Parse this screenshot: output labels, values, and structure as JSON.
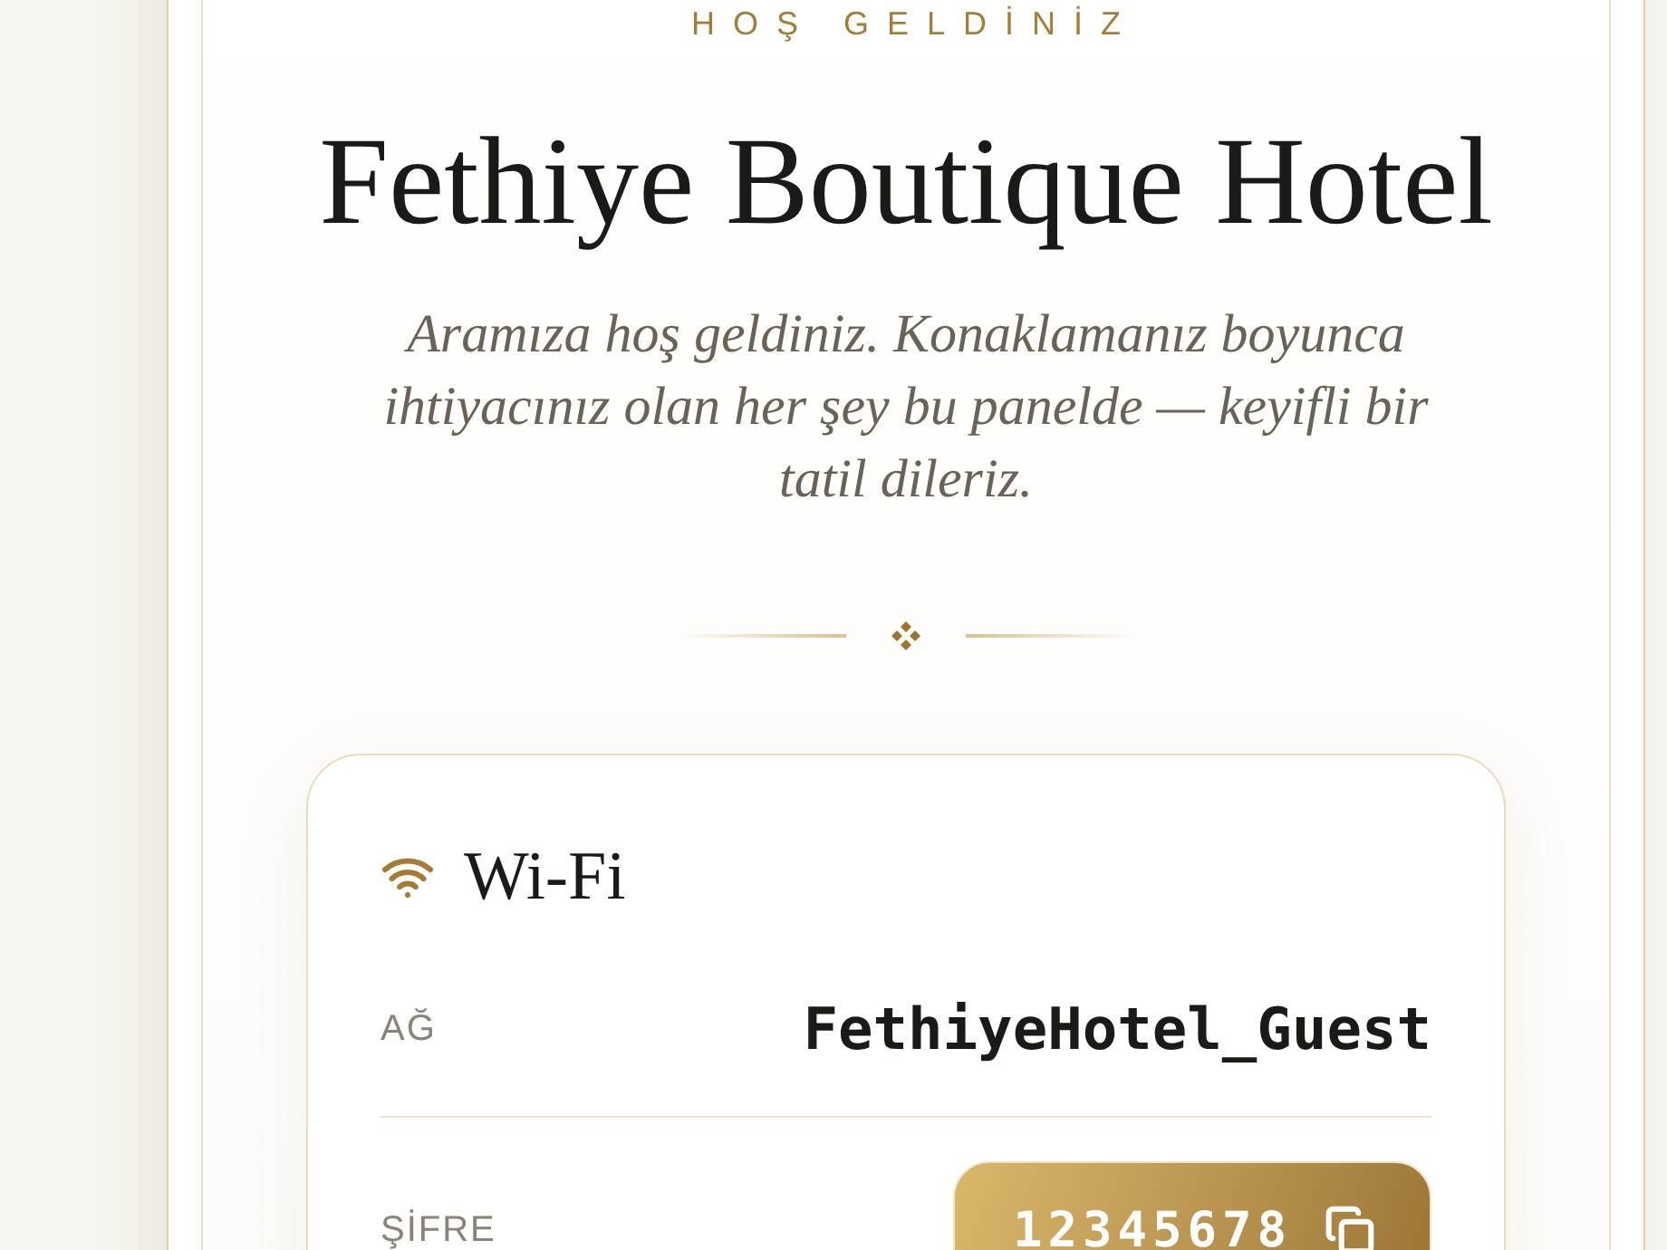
{
  "welcome": {
    "eyebrow": "HOŞ GELDİNİZ",
    "title": "Fethiye Boutique Hotel",
    "message": "Aramıza hoş geldiniz. Konaklamanız boyunca ihtiyacınız olan her şey bu panelde — keyifli bir tatil dileriz."
  },
  "wifi": {
    "title": "Wi-Fi",
    "fields": [
      {
        "kind": "text",
        "label": "AĞ",
        "value": "FethiyeHotel_Guest"
      },
      {
        "kind": "copy",
        "label": "ŞİFRE",
        "value": "12345678"
      }
    ]
  }
}
